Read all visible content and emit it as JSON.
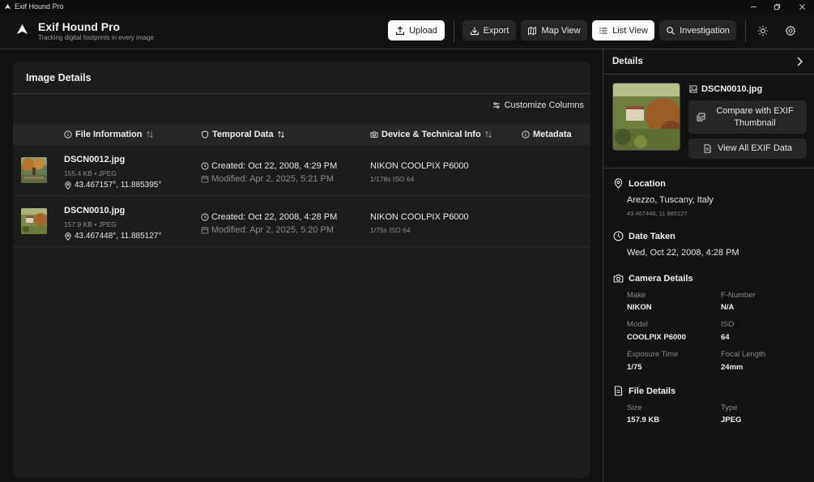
{
  "window": {
    "title": "Exif Hound Pro"
  },
  "header": {
    "app_name": "Exif Hound Pro",
    "tagline": "Tracking digital footprints in every image",
    "buttons": {
      "upload": "Upload",
      "export": "Export",
      "map_view": "Map View",
      "list_view": "List View",
      "investigation": "Investigation"
    },
    "active_view": "List View"
  },
  "image_details": {
    "title": "Image Details",
    "customize_label": "Customize Columns",
    "columns": [
      "File Information",
      "Temporal Data",
      "Device & Technical Info",
      "Metadata"
    ],
    "rows": [
      {
        "filename": "DSCN0012.jpg",
        "meta": "155.4 KB • JPEG",
        "coords": "43.467157°, 11.885395°",
        "created": "Created: Oct 22, 2008, 4:29 PM",
        "modified": "Modified: Apr 2, 2025, 5:21 PM",
        "device": "NIKON COOLPIX P6000",
        "exposure": "1/178s ISO 64"
      },
      {
        "filename": "DSCN0010.jpg",
        "meta": "157.9 KB • JPEG",
        "coords": "43.467448°, 11.885127°",
        "created": "Created: Oct 22, 2008, 4:28 PM",
        "modified": "Modified: Apr 2, 2025, 5:20 PM",
        "device": "NIKON COOLPIX P6000",
        "exposure": "1/75s ISO 64"
      }
    ]
  },
  "details": {
    "title": "Details",
    "filename": "DSCN0010.jpg",
    "compare_button": "Compare with EXIF Thumbnail",
    "view_all_button": "View All EXIF Data",
    "location": {
      "heading": "Location",
      "place": "Arezzo, Tuscany, Italy",
      "coords": "43.467448, 11.885127"
    },
    "date_taken": {
      "heading": "Date Taken",
      "value": "Wed, Oct 22, 2008, 4:28 PM"
    },
    "camera": {
      "heading": "Camera Details",
      "make_label": "Make",
      "make": "NIKON",
      "fnumber_label": "F-Number",
      "fnumber": "N/A",
      "model_label": "Model",
      "model": "COOLPIX P6000",
      "iso_label": "ISO",
      "iso": "64",
      "exposure_label": "Exposure Time",
      "exposure": "1/75",
      "focal_label": "Focal Length",
      "focal": "24mm"
    },
    "file": {
      "heading": "File Details",
      "size_label": "Size",
      "size": "157.9 KB",
      "type_label": "Type",
      "type": "JPEG"
    }
  },
  "icons": {
    "upload": "upload-icon",
    "export": "download-icon",
    "map": "map-icon",
    "list": "list-icon",
    "investigation": "search-icon",
    "theme": "sun-icon",
    "settings": "gear-icon",
    "sort": "sort-arrows-icon"
  }
}
